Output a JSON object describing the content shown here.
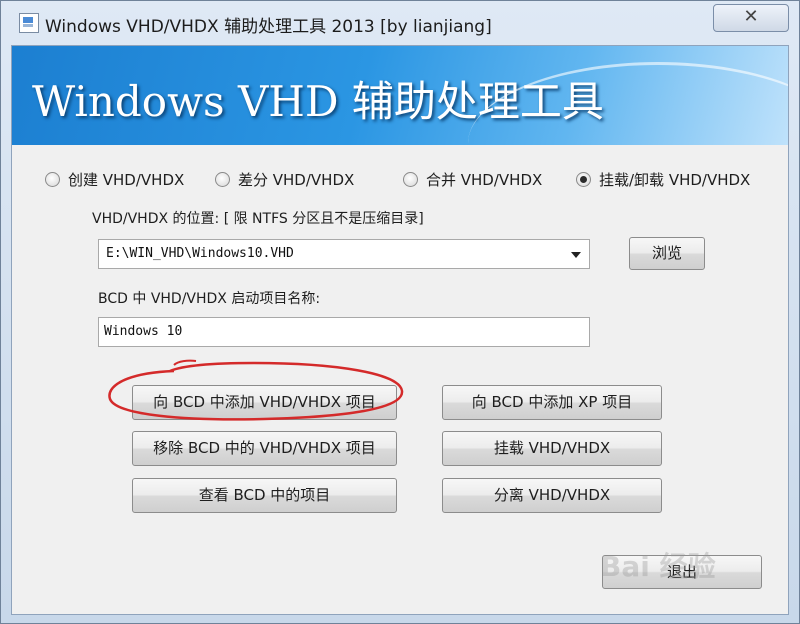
{
  "window": {
    "title": "Windows VHD/VHDX 辅助处理工具 2013 [by lianjiang]",
    "close_label": "✕"
  },
  "banner": {
    "title": "Windows VHD 辅助处理工具"
  },
  "mode": {
    "options": [
      {
        "label": "创建 VHD/VHDX",
        "checked": false
      },
      {
        "label": "差分 VHD/VHDX",
        "checked": false
      },
      {
        "label": "合并 VHD/VHDX",
        "checked": false
      },
      {
        "label": "挂载/卸载 VHD/VHDX",
        "checked": true
      }
    ]
  },
  "location": {
    "label": "VHD/VHDX 的位置: [ 限 NTFS 分区且不是压缩目录]",
    "value": "E:\\WIN_VHD\\Windows10.VHD",
    "browse_label": "浏览"
  },
  "bcd_name": {
    "label": "BCD 中 VHD/VHDX 启动项目名称:",
    "value": "Windows 10"
  },
  "actions": {
    "add_vhd": "向 BCD 中添加 VHD/VHDX 项目",
    "add_xp": "向 BCD 中添加 XP 项目",
    "remove_vhd": "移除 BCD 中的 VHD/VHDX 项目",
    "mount": "挂载 VHD/VHDX",
    "view_bcd": "查看 BCD 中的项目",
    "detach": "分离 VHD/VHDX",
    "exit": "退出"
  },
  "watermark": {
    "text": "Bai 经验"
  },
  "colors": {
    "annotation": "#d42a2a",
    "banner_blue": "#1c7fd1"
  }
}
